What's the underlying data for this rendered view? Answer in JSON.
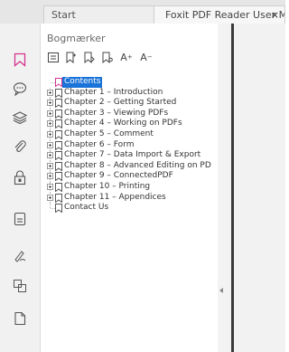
{
  "tabs": {
    "start": "Start",
    "document": "Foxit PDF Reader User M...",
    "close": "×"
  },
  "left_toolbar": {
    "icons": [
      "bookmark-icon",
      "comment-icon",
      "layers-icon",
      "attachment-icon",
      "security-icon",
      "pages-icon",
      "signature-icon",
      "compare-icon",
      "document-icon"
    ]
  },
  "panel": {
    "title": "Bogmærker",
    "toolbar_icons": [
      "options-icon",
      "add-bookmark-icon",
      "new-bookmark-icon",
      "bookmark-settings-icon",
      "enlarge-text-icon",
      "shrink-text-icon"
    ],
    "toolbar_glyphs": [
      "A",
      "A"
    ],
    "items": [
      {
        "label": "Contents",
        "expandable": false,
        "selected": true
      },
      {
        "label": "Chapter 1 – Introduction",
        "expandable": true,
        "selected": false
      },
      {
        "label": "Chapter 2 – Getting Started",
        "expandable": true,
        "selected": false
      },
      {
        "label": "Chapter 3 – Viewing PDFs",
        "expandable": true,
        "selected": false
      },
      {
        "label": "Chapter 4 – Working on PDFs",
        "expandable": true,
        "selected": false
      },
      {
        "label": "Chapter 5 – Comment",
        "expandable": true,
        "selected": false
      },
      {
        "label": "Chapter 6 – Form",
        "expandable": true,
        "selected": false
      },
      {
        "label": "Chapter 7 – Data Import & Export",
        "expandable": true,
        "selected": false
      },
      {
        "label": "Chapter 8 – Advanced Editing on PD",
        "expandable": true,
        "selected": false
      },
      {
        "label": "Chapter 9 – ConnectedPDF",
        "expandable": true,
        "selected": false
      },
      {
        "label": "Chapter 10 – Printing",
        "expandable": true,
        "selected": false
      },
      {
        "label": "Chapter 11 – Appendices",
        "expandable": true,
        "selected": false
      },
      {
        "label": "Contact Us",
        "expandable": false,
        "selected": false
      }
    ]
  },
  "colors": {
    "accent": "#d6338e",
    "selection": "#1a73d8"
  }
}
